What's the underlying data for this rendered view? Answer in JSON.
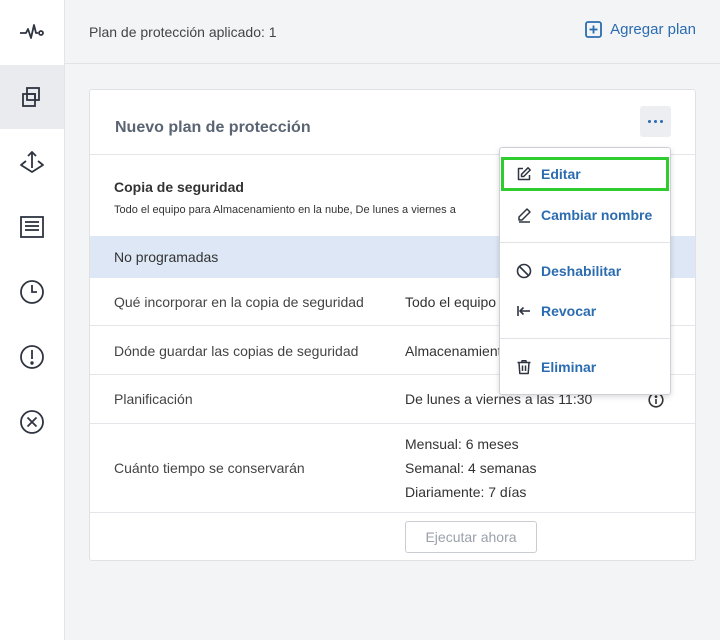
{
  "rail": {
    "items": [
      {
        "icon": "activity-icon"
      },
      {
        "icon": "plans-icon",
        "active": true
      },
      {
        "icon": "recovery-icon"
      },
      {
        "icon": "reports-icon"
      },
      {
        "icon": "history-icon"
      },
      {
        "icon": "alerts-icon"
      },
      {
        "icon": "close-circle-icon"
      }
    ]
  },
  "header": {
    "applied_text": "Plan de protección aplicado: 1",
    "add_plan_label": "Agregar plan"
  },
  "card": {
    "title": "Nuevo plan de protección",
    "backup_title": "Copia de seguridad",
    "backup_description": "Todo el equipo para Almacenamiento en la nube, De lunes a viernes a",
    "status": "No programadas",
    "rows": [
      {
        "label": "Qué incorporar en la copia de seguridad",
        "value": "Todo el equipo"
      },
      {
        "label": "Dónde guardar las copias de seguridad",
        "value": "Almacenamiento en la nube"
      },
      {
        "label": "Planificación",
        "value": "De lunes a viernes a las 11:30"
      },
      {
        "label": "Cuánto tiempo se conservarán",
        "values": [
          "Mensual: 6 meses",
          "Semanal: 4 semanas",
          "Diariamente: 7 días"
        ]
      }
    ],
    "run_button": "Ejecutar ahora"
  },
  "menu": {
    "items": [
      {
        "label": "Editar",
        "icon": "edit-icon",
        "highlighted": true
      },
      {
        "label": "Cambiar nombre",
        "icon": "pen-icon"
      },
      {
        "label": "Deshabilitar",
        "icon": "disable-icon"
      },
      {
        "label": "Revocar",
        "icon": "revoke-icon"
      },
      {
        "label": "Eliminar",
        "icon": "trash-icon"
      }
    ]
  },
  "colors": {
    "accent": "#2b6cb0",
    "highlight_border": "#2ecc2e",
    "status_row_bg": "#dde7f5"
  }
}
